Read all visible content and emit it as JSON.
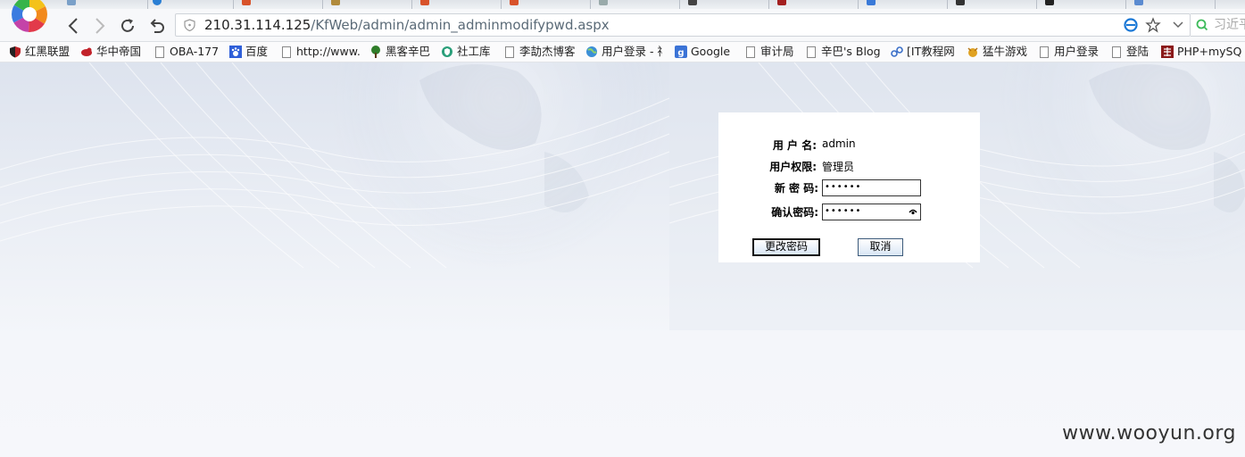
{
  "browser": {
    "address_bar": {
      "url_host": "210.31.114.125",
      "url_path": "/KfWeb/admin/admin_adminmodifypwd.aspx"
    },
    "search_placeholder": "习近平",
    "bookmarks": [
      {
        "label": "红黑联盟",
        "icon": "shield-icon"
      },
      {
        "label": "华中帝国",
        "icon": "bird-icon"
      },
      {
        "label": "OBA-177",
        "icon": "page-icon"
      },
      {
        "label": "百度",
        "icon": "baidu-paw-icon"
      },
      {
        "label": "http://www.",
        "icon": "page-icon"
      },
      {
        "label": "黑客辛巴",
        "icon": "tree-icon"
      },
      {
        "label": "社工库",
        "icon": "shield-green-icon"
      },
      {
        "label": "李劼杰博客",
        "icon": "page-icon"
      },
      {
        "label": "用户登录 - 祥",
        "icon": "globe-icon"
      },
      {
        "label": "Google",
        "icon": "google-icon"
      },
      {
        "label": "审计局",
        "icon": "page-icon"
      },
      {
        "label": "辛巴's Blog",
        "icon": "page-icon"
      },
      {
        "label": "[IT教程网",
        "icon": "link-icon"
      },
      {
        "label": "猛牛游戏",
        "icon": "bull-icon"
      },
      {
        "label": "用户登录",
        "icon": "page-icon"
      },
      {
        "label": "登陆",
        "icon": "page-icon"
      },
      {
        "label": "PHP+mySQ",
        "icon": "ji-icon"
      }
    ]
  },
  "form": {
    "username_label": "用 户 名:",
    "username_value": "admin",
    "permission_label": "用户权限:",
    "permission_value": "管理员",
    "new_password_label": "新 密 码:",
    "new_password_value": "••••••",
    "confirm_password_label": "确认密码:",
    "confirm_password_value": "••••••",
    "submit_label": "更改密码",
    "cancel_label": "取消"
  },
  "watermark": "www.wooyun.org"
}
